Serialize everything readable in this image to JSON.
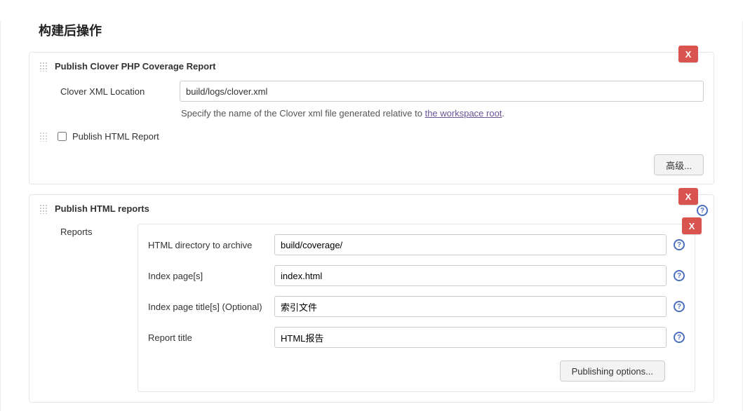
{
  "section_title": "构建后操作",
  "close_label": "X",
  "blocks": {
    "clover": {
      "title": "Publish Clover PHP Coverage Report",
      "xml_location": {
        "label": "Clover XML Location",
        "value": "build/logs/clover.xml"
      },
      "hint_prefix": "Specify the name of the Clover xml file generated relative to ",
      "hint_link": "the workspace root",
      "publish_html_checkbox": {
        "label": "Publish HTML Report",
        "checked": false
      },
      "advanced_button": "高级..."
    },
    "html_reports": {
      "title": "Publish HTML reports",
      "side_label": "Reports",
      "fields": {
        "dir": {
          "label": "HTML directory to archive",
          "value": "build/coverage/"
        },
        "index": {
          "label": "Index page[s]",
          "value": "index.html"
        },
        "titles": {
          "label": "Index page title[s] (Optional)",
          "value": "索引文件"
        },
        "report_title": {
          "label": "Report title",
          "value": "HTML报告"
        }
      },
      "publishing_options_button": "Publishing options..."
    }
  }
}
